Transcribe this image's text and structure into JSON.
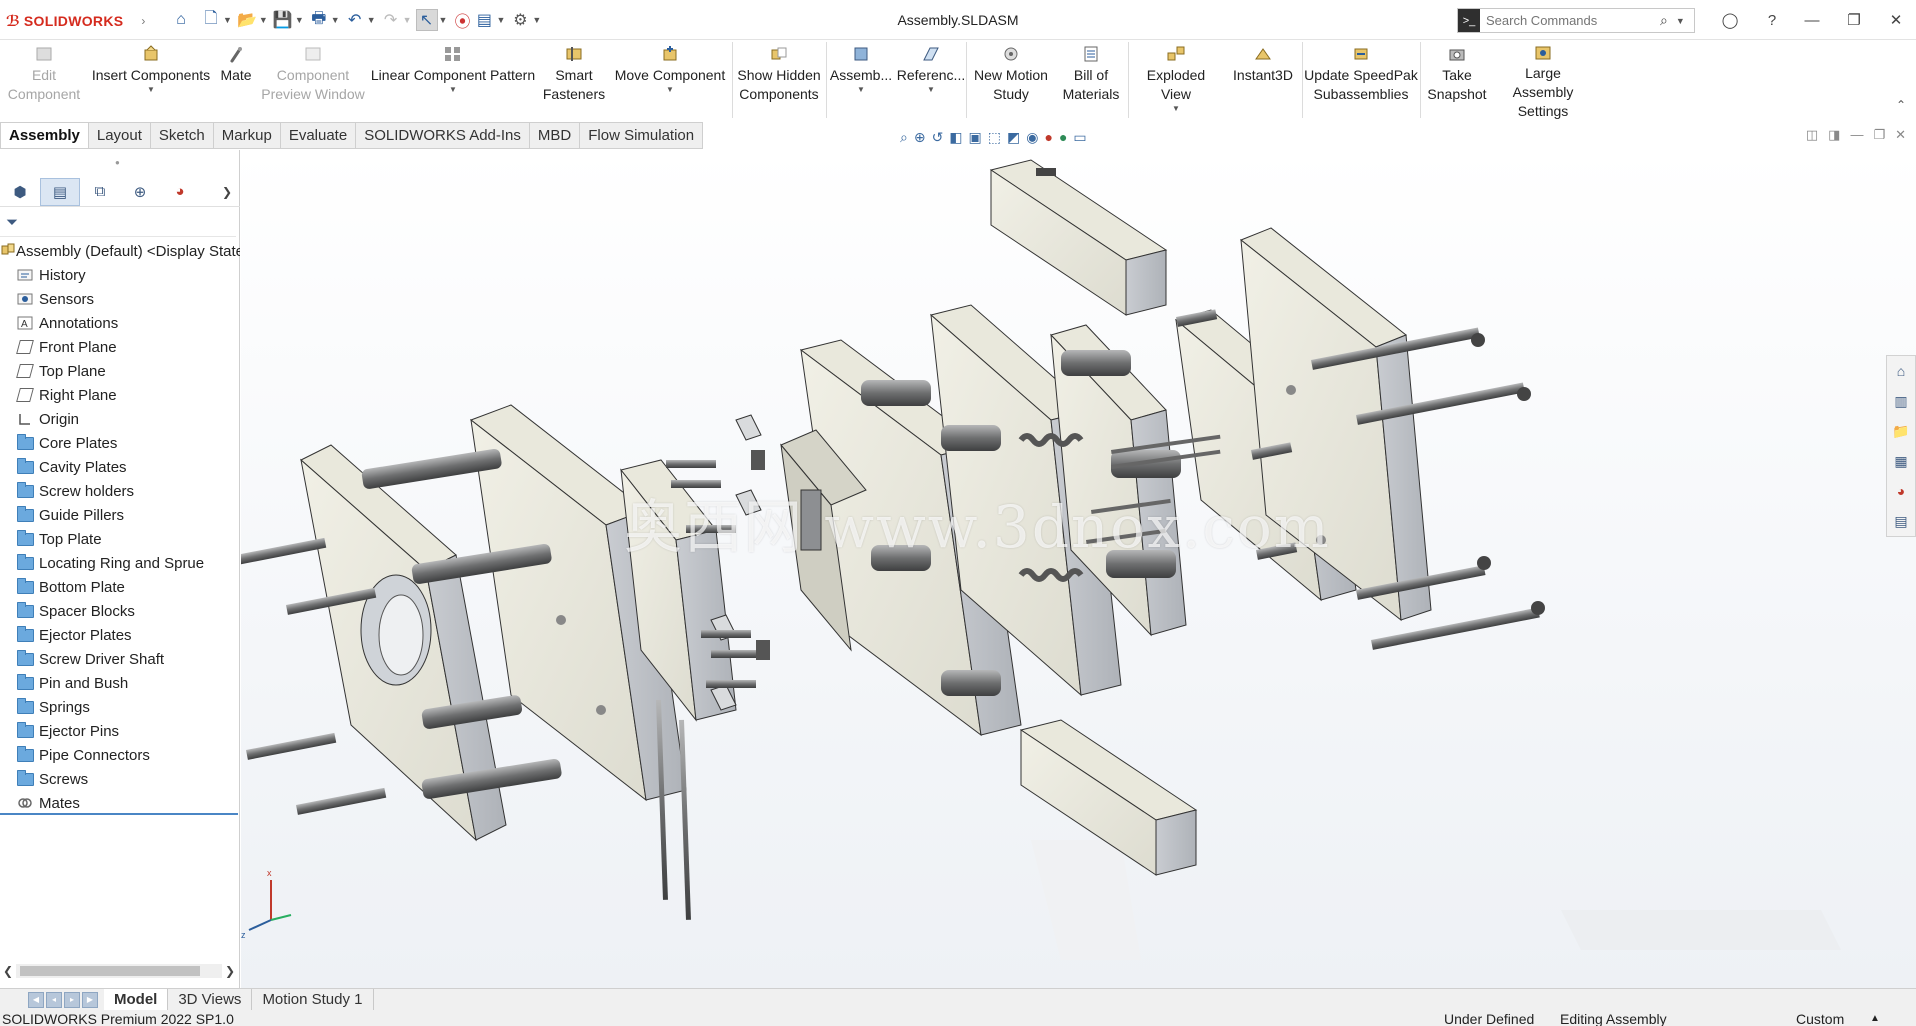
{
  "app": {
    "logo_text": "SOLIDWORKS",
    "title": "Assembly.SLDASM"
  },
  "search": {
    "placeholder": "Search Commands"
  },
  "ribbon": {
    "buttons": [
      {
        "label1": "Edit",
        "label2": "Component",
        "icon": "edit-component-icon",
        "disabled": true
      },
      {
        "label1": "Insert Components",
        "label2": "",
        "icon": "insert-components-icon"
      },
      {
        "label1": "Mate",
        "label2": "",
        "icon": "mate-icon"
      },
      {
        "label1": "Component",
        "label2": "Preview Window",
        "icon": "preview-window-icon",
        "disabled": true
      },
      {
        "label1": "Linear Component Pattern",
        "label2": "",
        "icon": "linear-pattern-icon"
      },
      {
        "label1": "Smart",
        "label2": "Fasteners",
        "icon": "smart-fasteners-icon"
      },
      {
        "label1": "Move Component",
        "label2": "",
        "icon": "move-component-icon"
      },
      {
        "label1": "Show Hidden",
        "label2": "Components",
        "icon": "show-hidden-icon"
      },
      {
        "label1": "Assemb...",
        "label2": "",
        "icon": "assembly-features-icon"
      },
      {
        "label1": "Referenc...",
        "label2": "",
        "icon": "reference-geometry-icon"
      },
      {
        "label1": "New Motion",
        "label2": "Study",
        "icon": "motion-study-icon"
      },
      {
        "label1": "Bill of",
        "label2": "Materials",
        "icon": "bom-icon"
      },
      {
        "label1": "Exploded View",
        "label2": "",
        "icon": "exploded-view-icon"
      },
      {
        "label1": "Instant3D",
        "label2": "",
        "icon": "instant3d-icon"
      },
      {
        "label1": "Update SpeedPak",
        "label2": "Subassemblies",
        "icon": "speedpak-icon"
      },
      {
        "label1": "Take",
        "label2": "Snapshot",
        "icon": "snapshot-icon"
      },
      {
        "label1": "Large Assembly",
        "label2": "Settings",
        "icon": "large-assembly-icon"
      }
    ]
  },
  "tabs": [
    "Assembly",
    "Layout",
    "Sketch",
    "Markup",
    "Evaluate",
    "SOLIDWORKS Add-Ins",
    "MBD",
    "Flow Simulation"
  ],
  "tree": {
    "root": "Assembly (Default) <Display State",
    "items": [
      {
        "label": "History",
        "icon": "history-icon"
      },
      {
        "label": "Sensors",
        "icon": "sensors-icon"
      },
      {
        "label": "Annotations",
        "icon": "annotations-icon"
      },
      {
        "label": "Front Plane",
        "icon": "plane-icon"
      },
      {
        "label": "Top Plane",
        "icon": "plane-icon"
      },
      {
        "label": "Right Plane",
        "icon": "plane-icon"
      },
      {
        "label": "Origin",
        "icon": "origin-icon"
      },
      {
        "label": "Core Plates",
        "icon": "folder-icon"
      },
      {
        "label": "Cavity Plates",
        "icon": "folder-icon"
      },
      {
        "label": "Screw holders",
        "icon": "folder-icon"
      },
      {
        "label": "Guide Pillers",
        "icon": "folder-icon"
      },
      {
        "label": "Top Plate",
        "icon": "folder-icon"
      },
      {
        "label": "Locating Ring and Sprue",
        "icon": "folder-icon"
      },
      {
        "label": "Bottom Plate",
        "icon": "folder-icon"
      },
      {
        "label": "Spacer Blocks",
        "icon": "folder-icon"
      },
      {
        "label": "Ejector Plates",
        "icon": "folder-icon"
      },
      {
        "label": "Screw Driver Shaft",
        "icon": "folder-icon"
      },
      {
        "label": "Pin and Bush",
        "icon": "folder-icon"
      },
      {
        "label": "Springs",
        "icon": "folder-icon"
      },
      {
        "label": "Ejector Pins",
        "icon": "folder-icon"
      },
      {
        "label": "Pipe Connectors",
        "icon": "folder-icon"
      },
      {
        "label": "Screws",
        "icon": "folder-icon"
      },
      {
        "label": "Mates",
        "icon": "mates-icon"
      }
    ]
  },
  "watermark": "奥西网 www.3dnox.com",
  "bottom_tabs": [
    "Model",
    "3D Views",
    "Motion Study 1"
  ],
  "status": {
    "product": "SOLIDWORKS Premium 2022 SP1.0",
    "defined": "Under Defined",
    "mode": "Editing Assembly",
    "units": "Custom"
  },
  "colors": {
    "accent": "#2b5e9c",
    "brand": "#d52b1e",
    "folder": "#6ba9de",
    "plate": "#ecebe0"
  }
}
